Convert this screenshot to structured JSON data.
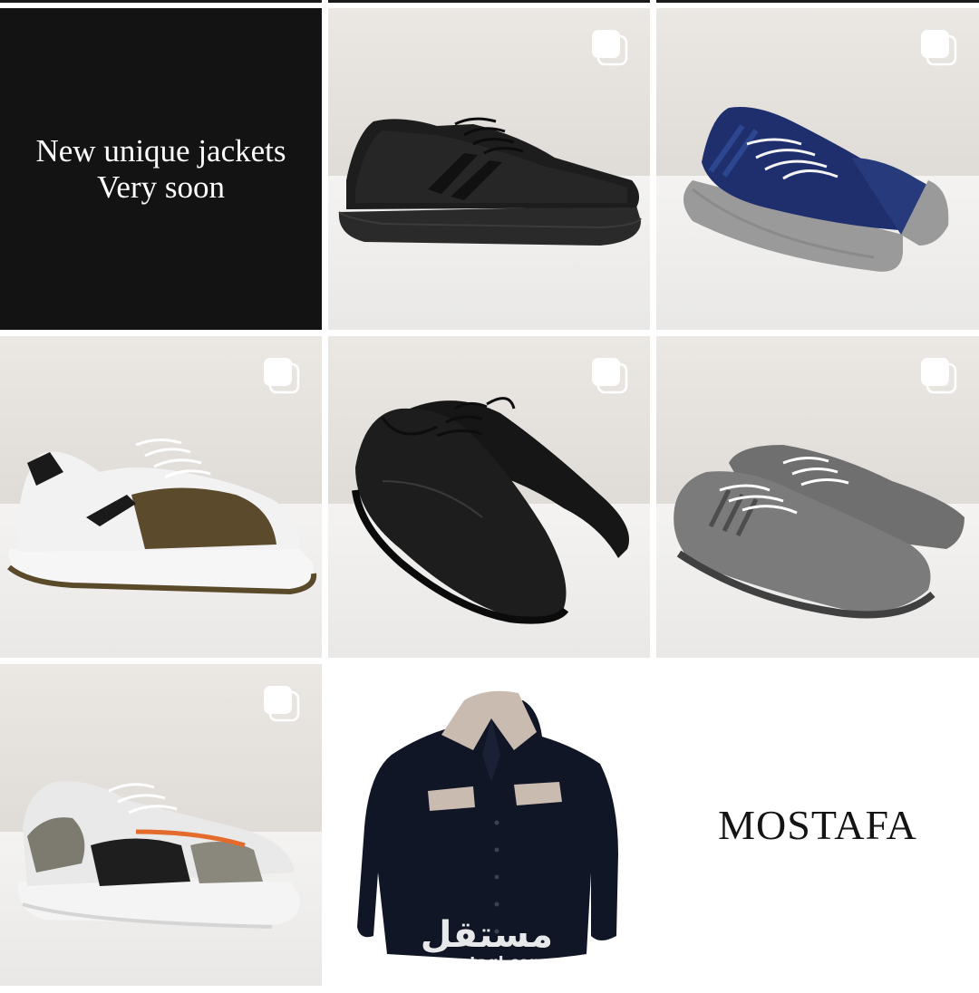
{
  "promo": {
    "line1": "New unique jackets",
    "line2": "Very soon"
  },
  "brand": {
    "name": "MOSTAFA"
  },
  "watermark": {
    "arabic": "مستقل",
    "latin": "mostaql.com"
  },
  "posts": [
    {
      "name": "black-mesh-sneaker",
      "icon": "multiple-images-icon"
    },
    {
      "name": "navy-canvas-sneaker",
      "icon": "multiple-images-icon"
    },
    {
      "name": "white-olive-sneaker",
      "icon": "multiple-images-icon"
    },
    {
      "name": "black-leather-derby",
      "icon": "multiple-images-icon"
    },
    {
      "name": "grey-mesh-sneaker",
      "icon": "multiple-images-icon"
    },
    {
      "name": "chunky-grey-sneaker",
      "icon": "multiple-images-icon"
    },
    {
      "name": "navy-jacket",
      "icon": ""
    }
  ],
  "colors": {
    "promo_bg": "#131313",
    "promo_text": "#ffffff",
    "brand_text": "#141414"
  }
}
